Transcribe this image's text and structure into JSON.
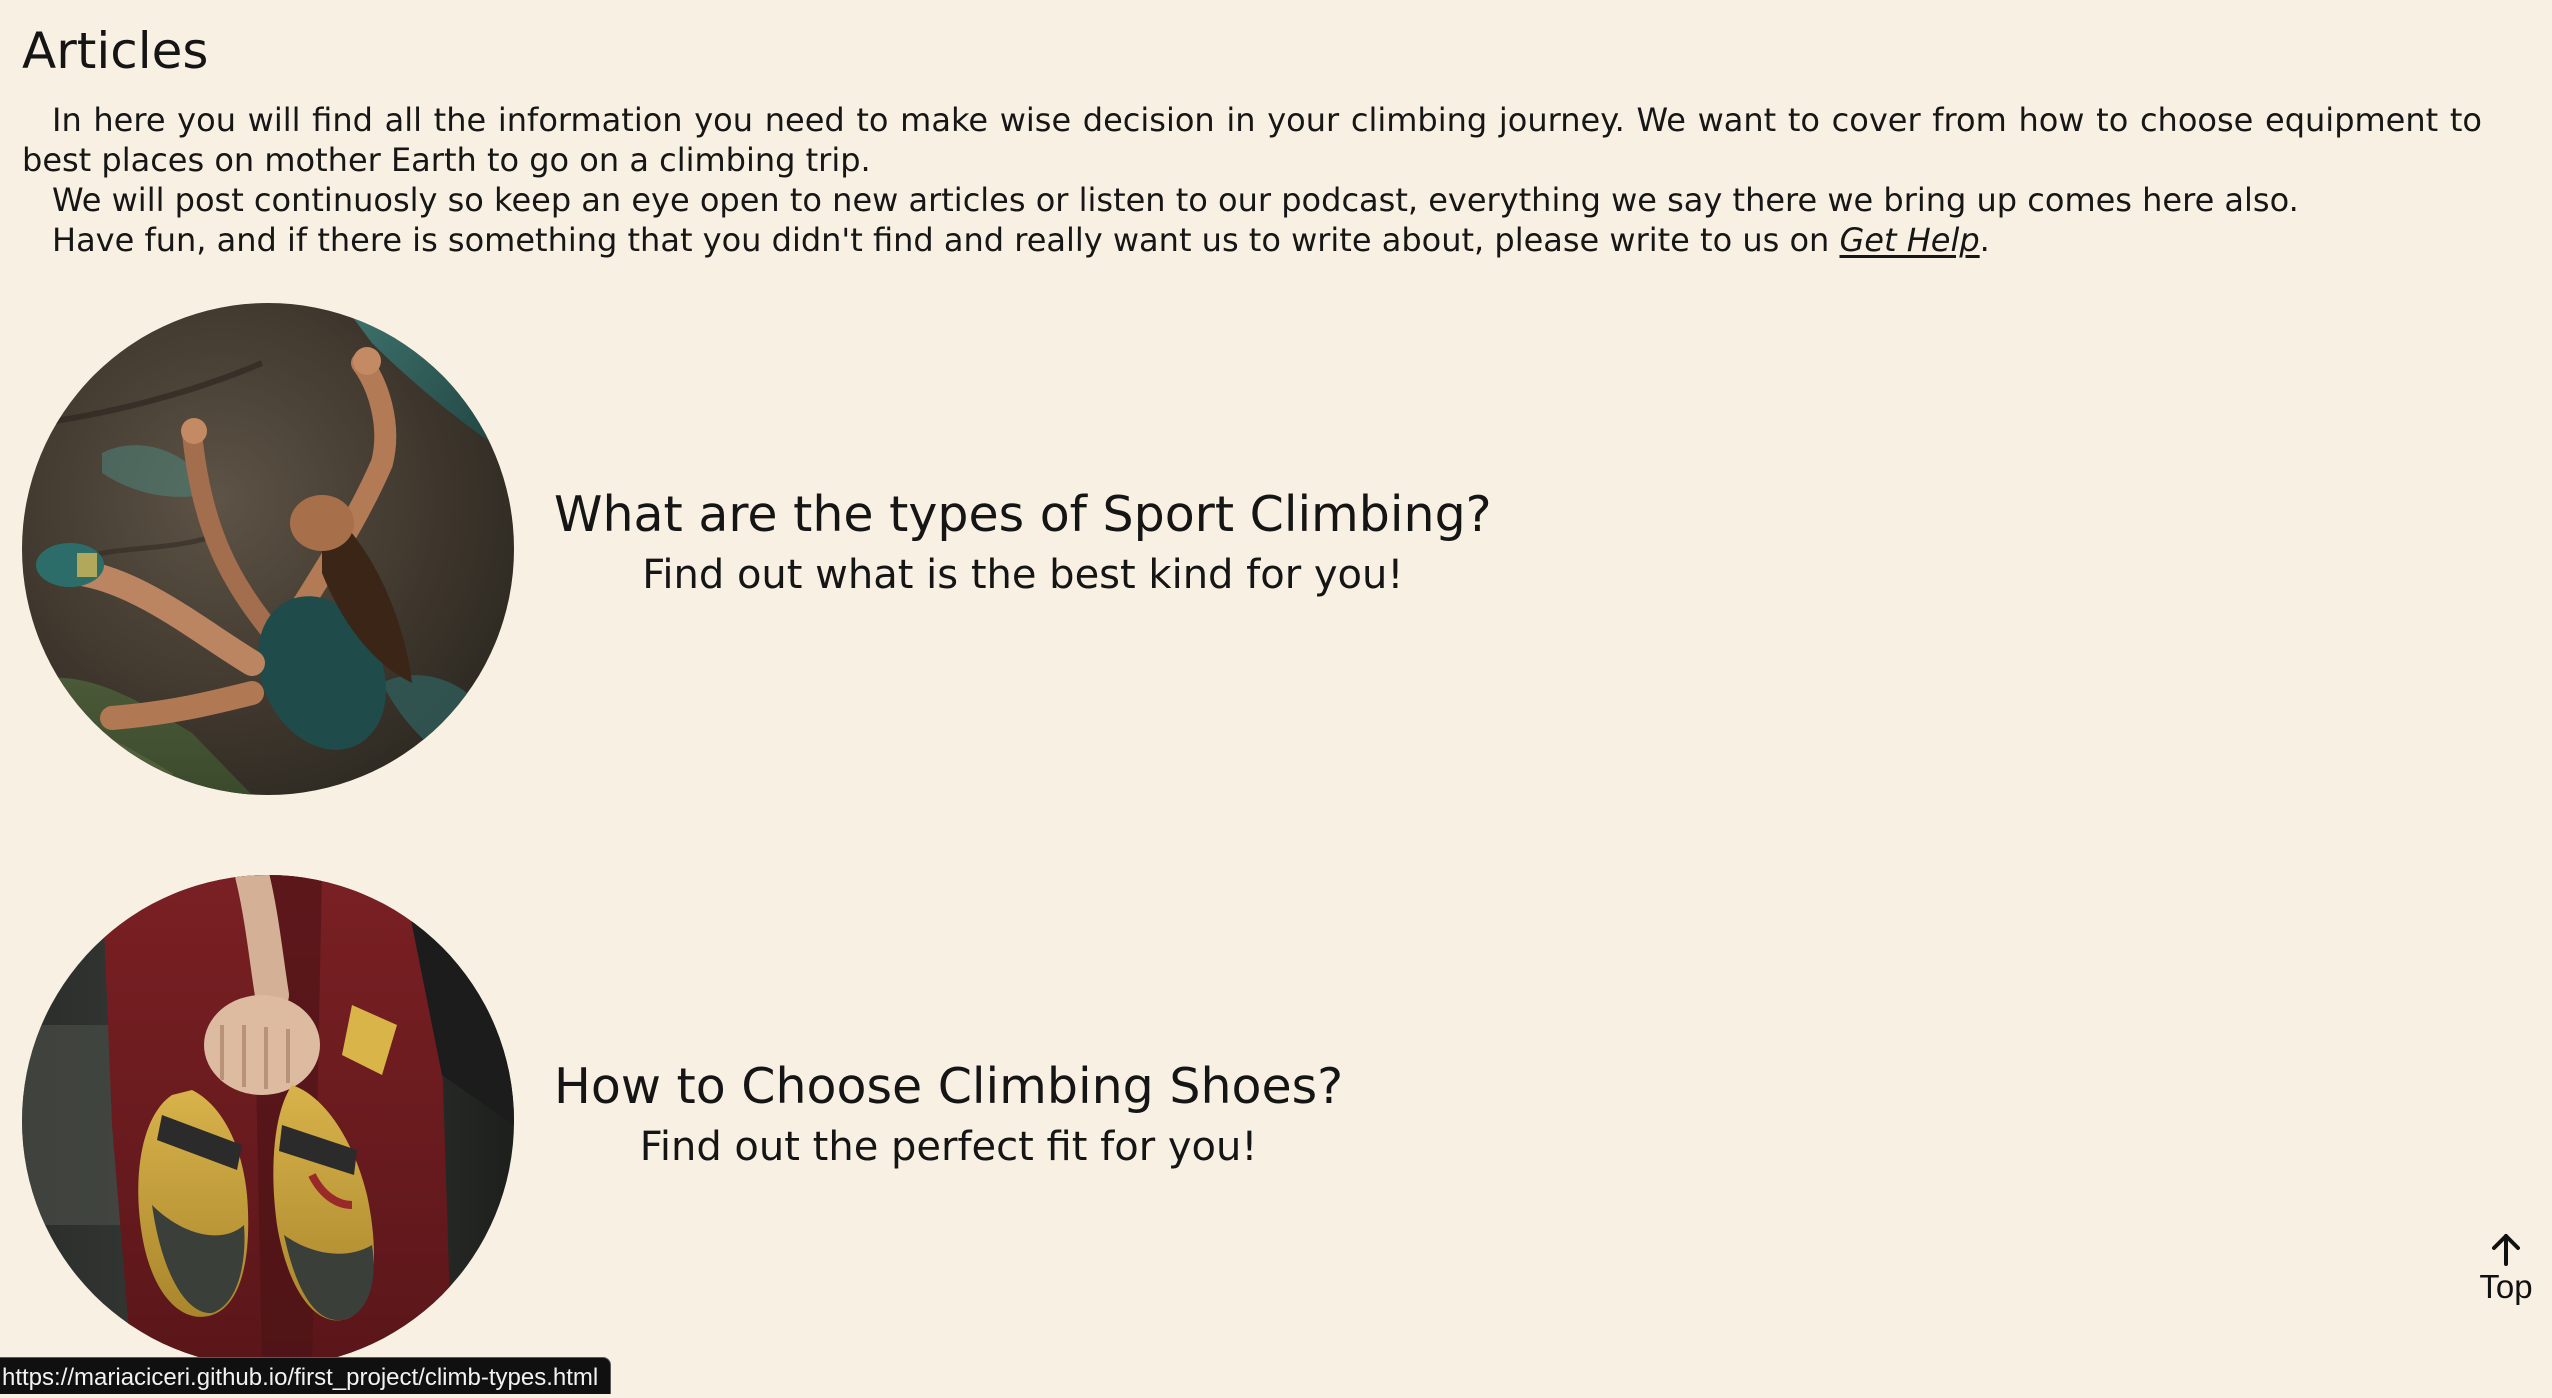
{
  "page": {
    "title": "Articles",
    "intro": {
      "p1": "In here you will find all the information you need to make wise decision in your climbing journey. We want to cover from how to choose equipment to best places on mother Earth to go on a climbing trip.",
      "p2": "We will post continuosly so keep an eye open to new articles or listen to our podcast, everything we say there we bring up comes here also.",
      "p3_before": "Have fun, and if there is something that you didn't find and really want us to write about, please write to us on ",
      "p3_link": "Get Help",
      "p3_after": "."
    }
  },
  "articles": [
    {
      "title": "What are the types of Sport Climbing?",
      "subtitle": "Find out what is the best kind for you!",
      "image": "climber-on-boulder-photo"
    },
    {
      "title": "How to Choose Climbing Shoes?",
      "subtitle": "Find out the perfect fit for you!",
      "image": "climbing-shoes-in-hand-photo"
    }
  ],
  "top_button": {
    "icon": "arrow-up-icon",
    "label": "Top"
  },
  "status_bar": {
    "url": "https://mariaciceri.github.io/first_project/climb-types.html"
  },
  "colors": {
    "background": "#f8f0e2",
    "text": "#151515",
    "status_bar_bg": "#101010"
  }
}
